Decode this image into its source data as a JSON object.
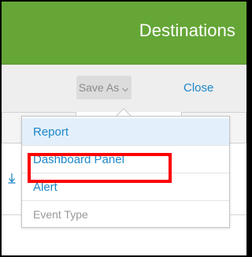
{
  "header": {
    "title": "Destinations",
    "bg_color": "#65a637"
  },
  "toolbar": {
    "save_as_label": "Save As",
    "close_label": "Close"
  },
  "dropdown": {
    "items": [
      {
        "label": "Report",
        "state": "hover"
      },
      {
        "label": "Dashboard Panel",
        "state": "highlighted"
      },
      {
        "label": "Alert",
        "state": "normal"
      },
      {
        "label": "Event Type",
        "state": "disabled"
      }
    ]
  },
  "annotation": {
    "color": "#ff0000",
    "target": "Dashboard Panel"
  },
  "icons": {
    "dropdown_chevron": "chevron-down-icon",
    "sort_arrow": "down-arrow-icon"
  },
  "colors": {
    "link": "#1e87c8",
    "disabled": "#999999"
  }
}
